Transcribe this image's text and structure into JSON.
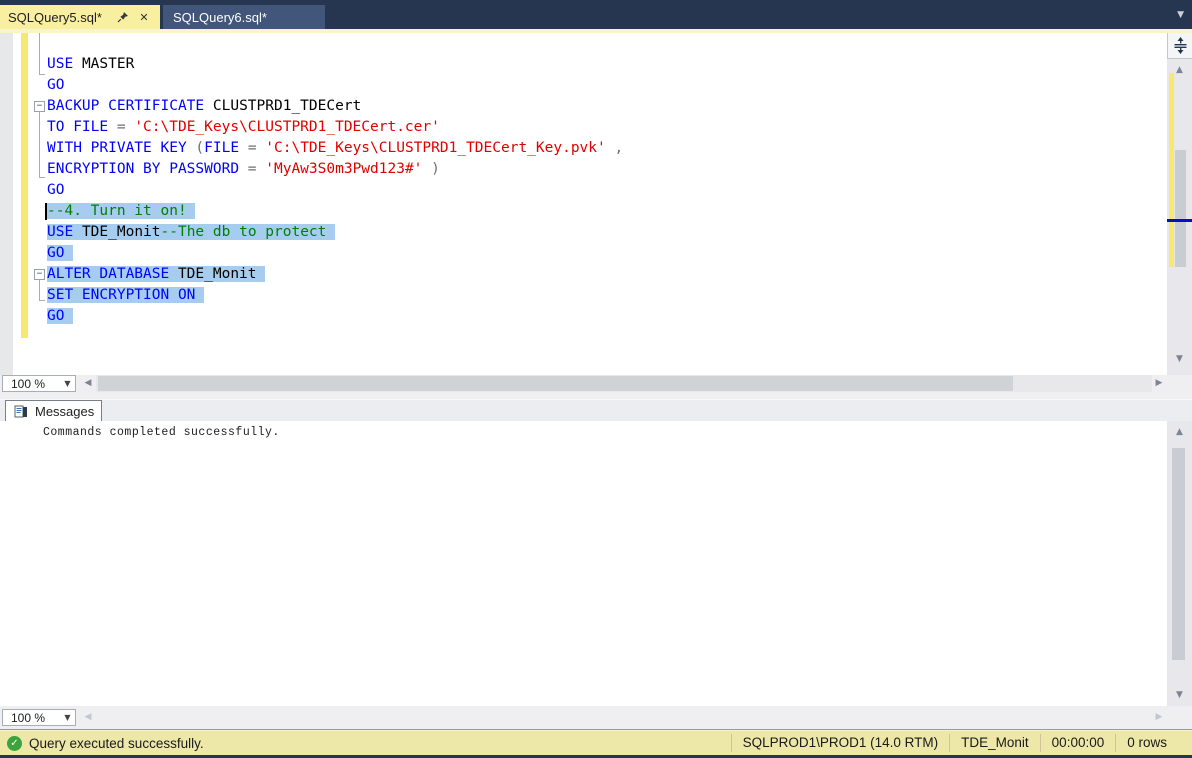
{
  "document_tabs": [
    {
      "label": "SQLQuery5.sql*",
      "active": true
    },
    {
      "label": "SQLQuery6.sql*",
      "active": false
    }
  ],
  "tab_icons": {
    "pin": "pin-icon",
    "close": "close-icon",
    "document_list": "chevron-down-icon"
  },
  "editor": {
    "zoom_value": "100 %",
    "lines": [
      {
        "tokens": []
      },
      {
        "tokens": [
          {
            "t": "USE",
            "c": "k"
          },
          {
            "t": " ",
            "c": "p"
          },
          {
            "t": "MASTER",
            "c": "i"
          }
        ]
      },
      {
        "tokens": [
          {
            "t": "GO",
            "c": "k"
          }
        ]
      },
      {
        "fold": true,
        "tokens": [
          {
            "t": "BACKUP CERTIFICATE",
            "c": "k"
          },
          {
            "t": " ",
            "c": "p"
          },
          {
            "t": "CLUSTPRD1_TDECert",
            "c": "i"
          }
        ]
      },
      {
        "tokens": [
          {
            "t": "TO FILE",
            "c": "k"
          },
          {
            "t": " ",
            "c": "p"
          },
          {
            "t": "=",
            "c": "o"
          },
          {
            "t": " ",
            "c": "p"
          },
          {
            "t": "'C:\\TDE_Keys\\CLUSTPRD1_TDECert.cer'",
            "c": "s"
          }
        ]
      },
      {
        "tokens": [
          {
            "t": "WITH PRIVATE KEY",
            "c": "k"
          },
          {
            "t": " ",
            "c": "p"
          },
          {
            "t": "(",
            "c": "o"
          },
          {
            "t": "FILE",
            "c": "k"
          },
          {
            "t": " ",
            "c": "p"
          },
          {
            "t": "=",
            "c": "o"
          },
          {
            "t": " ",
            "c": "p"
          },
          {
            "t": "'C:\\TDE_Keys\\CLUSTPRD1_TDECert_Key.pvk'",
            "c": "s"
          },
          {
            "t": " ",
            "c": "p"
          },
          {
            "t": ",",
            "c": "o"
          }
        ]
      },
      {
        "tokens": [
          {
            "t": "ENCRYPTION BY PASSWORD",
            "c": "k"
          },
          {
            "t": " ",
            "c": "p"
          },
          {
            "t": "=",
            "c": "o"
          },
          {
            "t": " ",
            "c": "p"
          },
          {
            "t": "'MyAw3S0m3Pwd123#'",
            "c": "s"
          },
          {
            "t": " ",
            "c": "p"
          },
          {
            "t": ")",
            "c": "o"
          }
        ]
      },
      {
        "tokens": [
          {
            "t": "GO",
            "c": "k"
          }
        ]
      },
      {
        "sel": true,
        "caret": true,
        "tokens": [
          {
            "t": "--4. Turn it on!",
            "c": "c"
          }
        ]
      },
      {
        "sel": true,
        "tokens": [
          {
            "t": "USE",
            "c": "k"
          },
          {
            "t": " ",
            "c": "p"
          },
          {
            "t": "TDE_Monit",
            "c": "i"
          },
          {
            "t": "--The db to protect",
            "c": "c"
          }
        ]
      },
      {
        "sel": true,
        "tokens": [
          {
            "t": "GO",
            "c": "k"
          }
        ]
      },
      {
        "sel": true,
        "fold": true,
        "tokens": [
          {
            "t": "ALTER DATABASE",
            "c": "k"
          },
          {
            "t": " ",
            "c": "p"
          },
          {
            "t": "TDE_Monit",
            "c": "i"
          }
        ]
      },
      {
        "sel": true,
        "tokens": [
          {
            "t": "SET ENCRYPTION ON",
            "c": "k"
          }
        ]
      },
      {
        "sel": true,
        "tokens": [
          {
            "t": "GO",
            "c": "k"
          }
        ]
      }
    ]
  },
  "messages_pane": {
    "tab_label": "Messages",
    "tab_icon": "messages-icon",
    "output": "Commands completed successfully.",
    "zoom_value": "100 %"
  },
  "status_bar": {
    "icon": "check-circle-icon",
    "message": "Query executed successfully.",
    "server": "SQLPROD1\\PROD1 (14.0 RTM)",
    "database": "TDE_Monit",
    "elapsed_time": "00:00:00",
    "row_count": "0 rows"
  },
  "colors": {
    "kw": "#0000ff",
    "id": "#000000",
    "str": "#e00000",
    "cmt": "#008000",
    "op": "#6f6f6f",
    "sel": "#a6cdf0",
    "tabbar": "#263550",
    "activetab": "#f9efa1",
    "inactivetab": "#41567a",
    "changebar": "#f7e96f",
    "status": "#ede8a8",
    "green": "#3ba43c"
  }
}
